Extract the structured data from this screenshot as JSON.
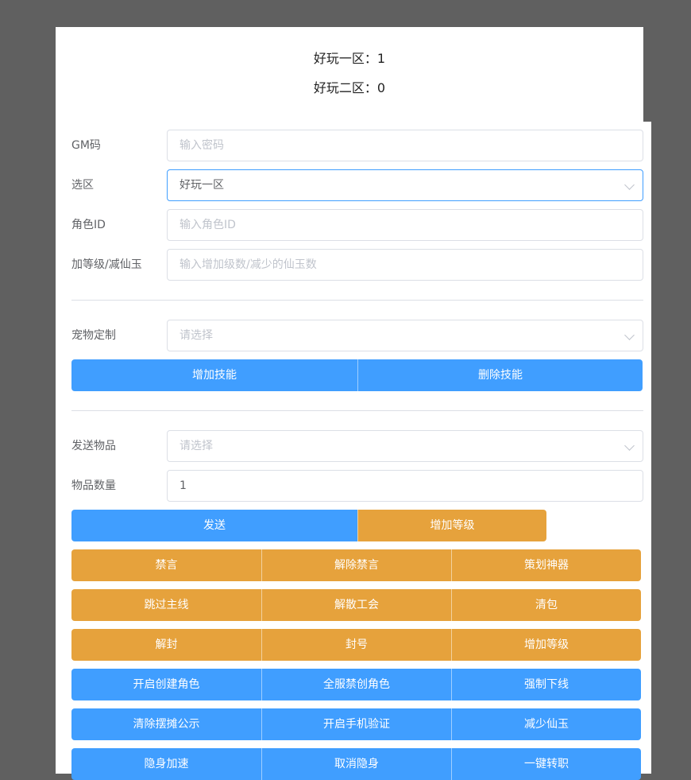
{
  "servers": [
    {
      "label": "好玩一区：1"
    },
    {
      "label": "好玩二区：0"
    }
  ],
  "form": {
    "gm_code": {
      "label": "GM码",
      "placeholder": "输入密码"
    },
    "zone": {
      "label": "选区",
      "value": "好玩一区"
    },
    "role_id": {
      "label": "角色ID",
      "placeholder": "输入角色ID"
    },
    "level_jade": {
      "label": "加等级/减仙玉",
      "placeholder": "输入增加级数/减少的仙玉数"
    },
    "pet": {
      "label": "宠物定制",
      "placeholder": "请选择"
    },
    "item": {
      "label": "发送物品",
      "placeholder": "请选择"
    },
    "item_qty": {
      "label": "物品数量",
      "value": "1"
    }
  },
  "pet_buttons": [
    "增加技能",
    "删除技能"
  ],
  "send_buttons": [
    "发送",
    "增加等级"
  ],
  "grid_buttons": [
    {
      "color": "orange",
      "labels": [
        "禁言",
        "解除禁言",
        "策划神器"
      ]
    },
    {
      "color": "orange",
      "labels": [
        "跳过主线",
        "解散工会",
        "清包"
      ]
    },
    {
      "color": "orange",
      "labels": [
        "解封",
        "封号",
        "增加等级"
      ]
    },
    {
      "color": "blue",
      "labels": [
        "开启创建角色",
        "全服禁创角色",
        "强制下线"
      ]
    },
    {
      "color": "blue",
      "labels": [
        "清除摆摊公示",
        "开启手机验证",
        "减少仙玉"
      ]
    },
    {
      "color": "blue",
      "labels": [
        "隐身加速",
        "取消隐身",
        "一键转职"
      ]
    }
  ],
  "colors": {
    "primary": "#409eff",
    "warning": "#e6a23c",
    "backdrop": "#606060"
  }
}
